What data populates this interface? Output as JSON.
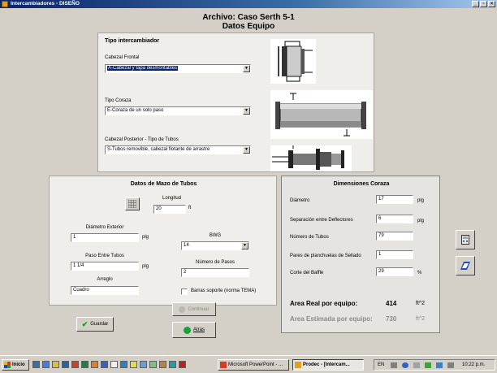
{
  "window": {
    "title": "Intercambiadores - DISEÑO",
    "minimize": "_",
    "maximize": "▫",
    "close": "×"
  },
  "header": {
    "archivo_label": "Archivo:",
    "archivo_name": "Caso Serth 5-1",
    "subtitle": "Datos Equipo"
  },
  "tipo": {
    "title": "Tipo intercambiador",
    "cabezal_frontal_label": "Cabezal Frontal",
    "cabezal_frontal_value": "A-Cabezal y tapa desmontables",
    "tipo_coraza_label": "Tipo Coraza",
    "tipo_coraza_value": "E-Coraza de un solo paso",
    "cabezal_posterior_label": "Cabezal Posterior - Tipo de Tubos",
    "cabezal_posterior_value": "S-Tubos removible, cabezal flotante de arrastre"
  },
  "mazo": {
    "title": "Datos de Mazo de Tubos",
    "longitud_label": "Longitud",
    "longitud_value": "20",
    "longitud_unit": "ft",
    "diam_ext_label": "Diámetro Exterior",
    "diam_ext_value": "1",
    "diam_ext_unit": "plg",
    "paso_label": "Paso Entre Tubos",
    "paso_value": "1 1/4",
    "paso_unit": "plg",
    "arreglo_label": "Arreglo",
    "arreglo_value": "Cuadro",
    "bwg_label": "BWG",
    "bwg_value": "14",
    "pasos_label": "Número de Pasos",
    "pasos_value": "2",
    "barras_label": "Barras soporte (norma TEMA)"
  },
  "coraza": {
    "title": "Dimensiones Coraza",
    "diametro_label": "Diámetro",
    "diametro_value": "17",
    "diametro_unit": "plg",
    "separacion_label": "Separación entre Deflectores",
    "separacion_value": "6",
    "separacion_unit": "plg",
    "num_tubos_label": "Número de Tubos",
    "num_tubos_value": "79",
    "pares_label": "Pares de planchuelas de Sellado",
    "pares_value": "1",
    "corte_label": "Corte del Baffle",
    "corte_value": "29",
    "corte_unit": "%"
  },
  "areas": {
    "real_label": "Area Real por equipo:",
    "real_value": "414",
    "real_unit": "ft^2",
    "estimada_label": "Area Estimada por equipo:",
    "estimada_value": "730",
    "estimada_unit": "ft^2"
  },
  "buttons": {
    "guardar": "Guardar",
    "continuar": "Continuar",
    "atras": "Atras"
  },
  "taskbar": {
    "start": "Inicio",
    "task1": "Microsoft PowerPoint - ...",
    "task2": "Prodec - [Intercam...",
    "lang": "EN",
    "clock": "10:22 p.m."
  }
}
